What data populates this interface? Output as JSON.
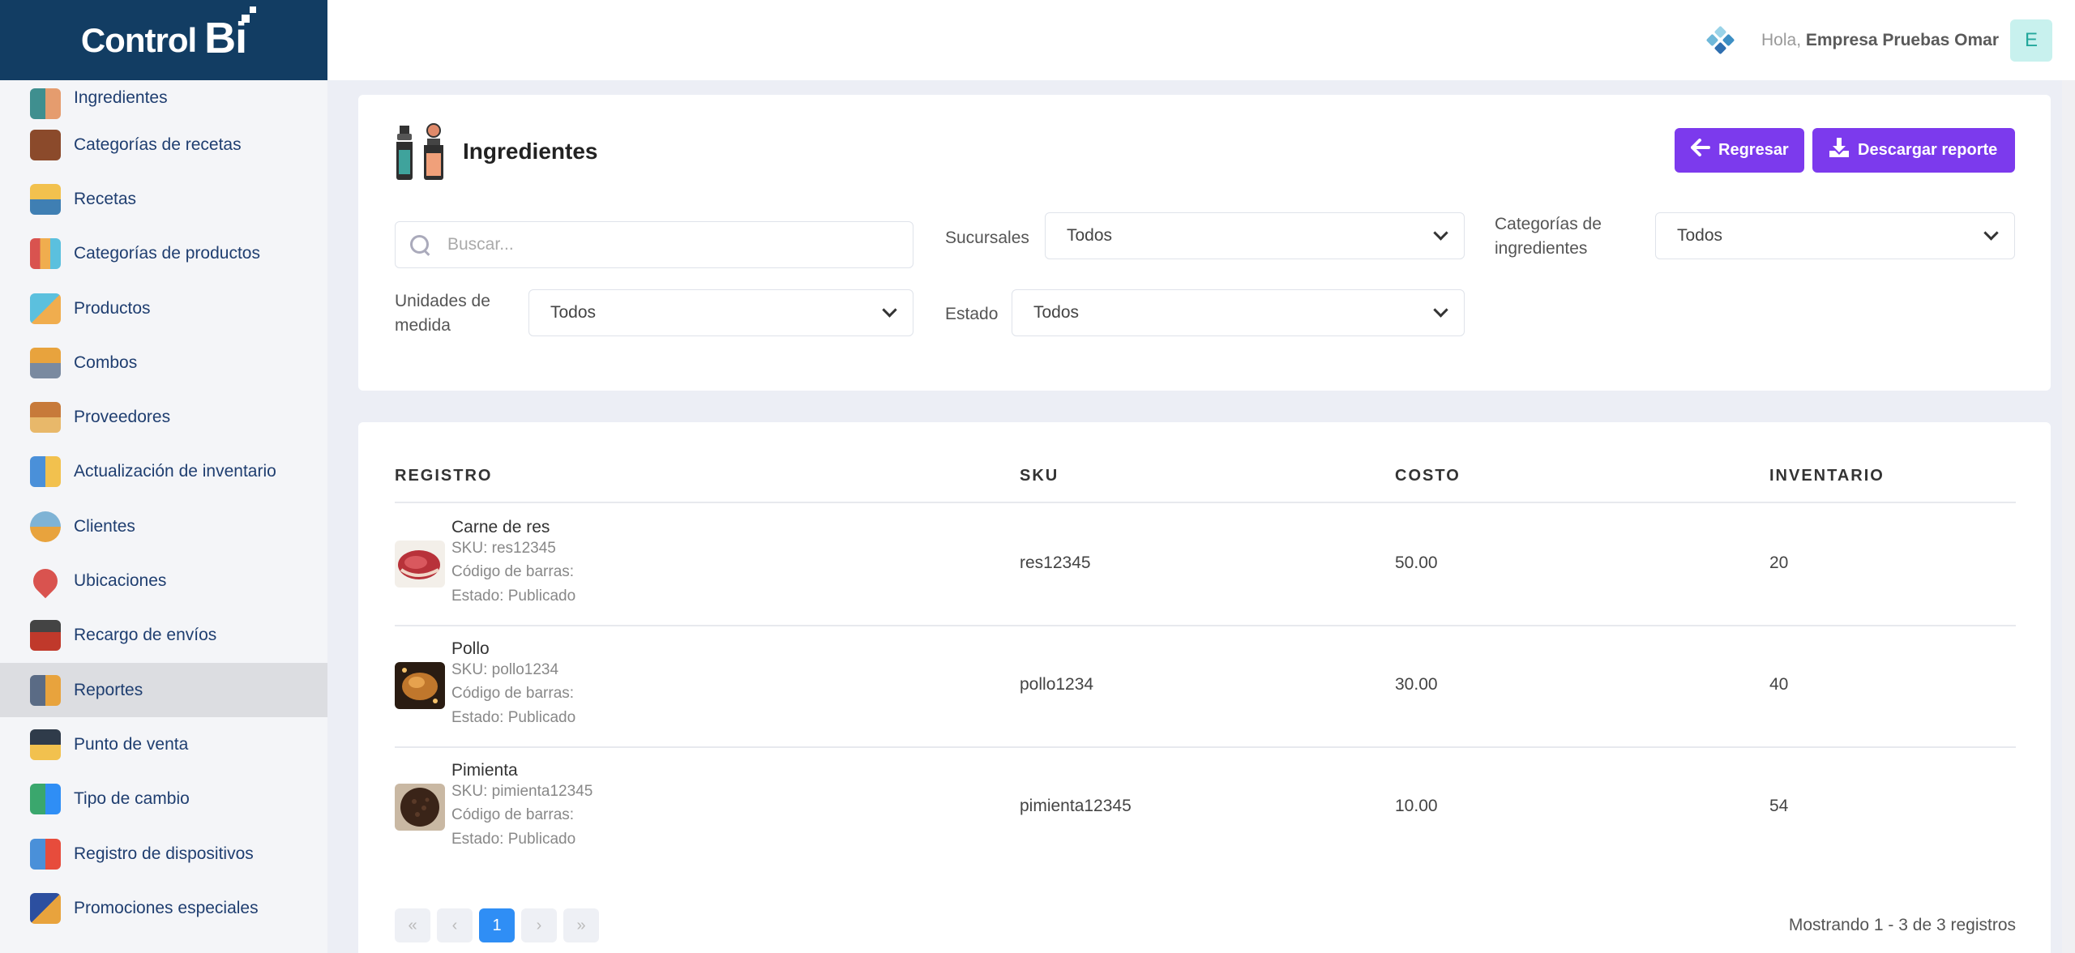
{
  "brand": {
    "logo_text": "Control",
    "logo_bi": "Bi"
  },
  "sidebar": {
    "items": [
      {
        "label": "Ingredientes",
        "icon": "ingredients-icon"
      },
      {
        "label": "Categorías de recetas",
        "icon": "recipe-categories-icon"
      },
      {
        "label": "Recetas",
        "icon": "recipes-icon"
      },
      {
        "label": "Categorías de productos",
        "icon": "product-categories-icon"
      },
      {
        "label": "Productos",
        "icon": "products-icon"
      },
      {
        "label": "Combos",
        "icon": "combos-icon"
      },
      {
        "label": "Proveedores",
        "icon": "suppliers-icon"
      },
      {
        "label": "Actualización de inventario",
        "icon": "inventory-update-icon"
      },
      {
        "label": "Clientes",
        "icon": "clients-icon"
      },
      {
        "label": "Ubicaciones",
        "icon": "locations-icon"
      },
      {
        "label": "Recargo de envíos",
        "icon": "shipping-surcharge-icon"
      },
      {
        "label": "Reportes",
        "icon": "reports-icon",
        "active": true
      },
      {
        "label": "Punto de venta",
        "icon": "point-of-sale-icon"
      },
      {
        "label": "Tipo de cambio",
        "icon": "exchange-rate-icon"
      },
      {
        "label": "Registro de dispositivos",
        "icon": "device-registry-icon"
      },
      {
        "label": "Promociones especiales",
        "icon": "special-promotions-icon"
      }
    ]
  },
  "header": {
    "greeting": "Hola,",
    "user_name": "Empresa Pruebas Omar",
    "avatar_letter": "E"
  },
  "page": {
    "title": "Ingredientes",
    "back_button": "Regresar",
    "download_button": "Descargar reporte"
  },
  "filters": {
    "search_placeholder": "Buscar...",
    "sucursales_label": "Sucursales",
    "sucursales_value": "Todos",
    "categorias_label_1": "Categorías de",
    "categorias_label_2": "ingredientes",
    "categorias_value": "Todos",
    "unidades_label_1": "Unidades de",
    "unidades_label_2": "medida",
    "unidades_value": "Todos",
    "estado_label": "Estado",
    "estado_value": "Todos"
  },
  "table": {
    "headers": [
      "REGISTRO",
      "SKU",
      "COSTO",
      "INVENTARIO"
    ],
    "rows": [
      {
        "name": "Carne de res",
        "sku_line": "SKU: res12345",
        "barcode_line": "Código de barras:",
        "status_line": "Estado: Publicado",
        "sku": "res12345",
        "cost": "50.00",
        "inventory": "20"
      },
      {
        "name": "Pollo",
        "sku_line": "SKU: pollo1234",
        "barcode_line": "Código de barras:",
        "status_line": "Estado: Publicado",
        "sku": "pollo1234",
        "cost": "30.00",
        "inventory": "40"
      },
      {
        "name": "Pimienta",
        "sku_line": "SKU: pimienta12345",
        "barcode_line": "Código de barras:",
        "status_line": "Estado: Publicado",
        "sku": "pimienta12345",
        "cost": "10.00",
        "inventory": "54"
      }
    ]
  },
  "pagination": {
    "first": "«",
    "prev": "‹",
    "current": "1",
    "next": "›",
    "last": "»",
    "summary": "Mostrando 1 - 3 de 3 registros"
  },
  "colors": {
    "brand_navy": "#123d63",
    "accent_purple": "#7c3aed",
    "page_active_blue": "#2f8ef5"
  }
}
